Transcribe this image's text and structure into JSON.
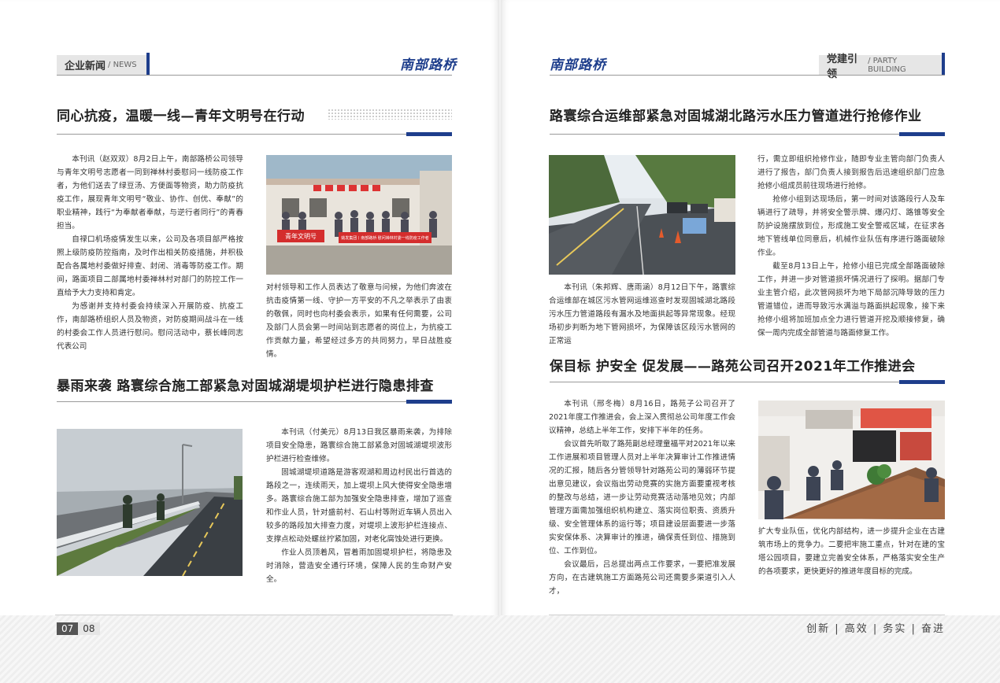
{
  "left": {
    "section_tab": "企业新闻",
    "section_tab_en": "/ NEWS",
    "brand": "南部路桥",
    "article1": {
      "title": "同心抗疫，温暖一线—青年文明号在行动",
      "paragraphs": [
        "本刊讯（赵双双）8月2日上午，南部路桥公司领导与青年文明号志愿者一同到禅林村委慰问一线防疫工作者，为他们送去了绿豆汤、方便面等物资，助力防疫抗疫工作，展现青年文明号“敬业、协作、创优、奉献”的职业精神，践行“为奉献者奉献，与逆行者同行”的青春担当。",
        "自禄口机场疫情发生以来，公司及各项目部严格按照上级防疫防控指南，及时作出相关防疫措施，并积极配合各属地村委做好排查、封闭、消毒等防疫工作。期间，路面项目二部属地村委禅林村对部门的防控工作一直给予大力支持和肯定。",
        "为感谢并支持村委会持续深入开展防疫、抗疫工作，南部路桥组织人员及物资，对防疫期间战斗在一线的村委会工作人员进行慰问。慰问活动中，蔡长峰同志代表公司"
      ],
      "continued": "对村领导和工作人员表达了敬意与问候，为他们奔波在抗击疫情第一线、守护一方平安的不凡之举表示了由衷的敬佩，同时也向村委会表示，如果有任何需要，公司及部门人员会第一时间站到志愿者的岗位上，为抗疫工作贡献力量，希望经过多方的共同努力，早日战胜疫情。",
      "photo_banner_left": "青年文明号",
      "photo_banner_right": "姚发集团丨南部路桥 慰问禅林村委一线防疫工作者"
    },
    "article2": {
      "title": "暴雨来袭 路寰综合施工部紧急对固城湖堤坝护栏进行隐患排查",
      "paragraphs": [
        "本刊讯（付美元）8月13日我区暴雨来袭，为排除项目安全隐患，路寰综合施工部紧急对固城湖堤坝波形护栏进行检查维修。",
        "固城湖堤坝道路是游客观湖和周边村民出行首选的路段之一，连续雨天，加上堤坝上风大使得安全隐患增多。路寰综合施工部为加强安全隐患排查，增加了巡查和作业人员，针对盛前村、石山村等附近车辆人员出入较多的路段加大排查力度，对堤坝上波形护栏连接点、支撑点松动处螺丝拧紧加固，对老化腐蚀处进行更换。",
        "作业人员顶着风，冒着雨加固堤坝护栏，将隐患及时消除，营造安全通行环境，保障人民的生命财产安全。"
      ]
    },
    "page_current": "07",
    "page_next": "08"
  },
  "right": {
    "brand": "南部路桥",
    "section_tab": "党建引领",
    "section_tab_en": "/ PARTY BUILDING",
    "article1": {
      "title": "路寰综合运维部紧急对固城湖北路污水压力管道进行抢修作业",
      "lead": "本刊讯（朱邦辉、唐雨涵）8月12日下午，路寰综合运维部在城区污水管网运维巡查时发现固城湖北路段污水压力管道路段有漏水及地面拱起等异常现象。经现场初步判断为地下管网损坏，为保障该区段污水管网的正常运",
      "paragraphs": [
        "行，需立即组织抢修作业，随即专业主管向部门负责人进行了报告，部门负责人接到报告后迅速组织部门应急抢修小组成员前往现场进行抢修。",
        "抢修小组到达现场后，第一时间对该路段行人及车辆进行了疏导，并将安全警示牌、爆闪灯、路锥等安全防护设施摆放到位，形成施工安全警戒区域，在征求各地下管线单位同意后，机械作业队伍有序进行路面破除作业。",
        "截至8月13日上午，抢修小组已完成全部路面破除工作，并进一步对管道损坏情况进行了探明。据部门专业主管介绍，此次管网损坏为地下局部沉降导致的压力管道错位，进而导致污水满溢与路面拱起现象，接下来抢修小组将加班加点全力进行管道开挖及顺接修复，确保一周内完成全部管道与路面修复工作。"
      ]
    },
    "article2": {
      "title": "保目标 护安全 促发展——路苑公司召开2021年工作推进会",
      "paragraphs": [
        "本刊讯（邢冬梅）8月16日，路苑子公司召开了2021年度工作推进会，会上深入贯彻总公司年度工作会议精神，总结上半年工作，安排下半年的任务。",
        "会议首先听取了路苑副总经理童福平对2021年以来工作进展和项目管理人员对上半年决算审计工作推进情况的汇报，随后各分管领导针对路苑公司的薄弱环节提出意见建议，会议指出劳动竞赛的实施方面要重视考核的整改与总结，进一步让劳动竞赛活动落地见效；内部管理方面需加强组织机构建立、落实岗位职责、资质升级、安全管理体系的运行等；项目建设层面要进一步落实安保体系、决算审计的推进，确保责任到位、措施到位、工作到位。",
        "会议最后，吕总提出两点工作要求，一要把准发展方向，在古建筑施工方面路苑公司还需要多渠道引入人才，"
      ],
      "continued": "扩大专业队伍，优化内部结构，进一步提升企业在古建筑市场上的竞争力。二要把牢施工重点，针对在建的宝塔公园项目，要建立完善安全体系，严格落实安全生产的各项要求，更快更好的推进年度目标的完成。"
    },
    "slogan": "创新 | 高效 | 务实 | 奋进"
  }
}
